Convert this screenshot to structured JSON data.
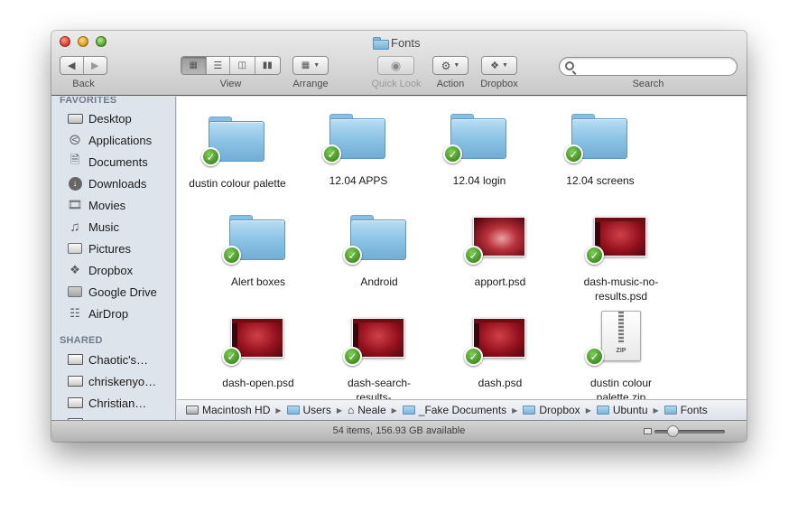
{
  "window": {
    "title": "Fonts"
  },
  "toolbar": {
    "back_label": "Back",
    "view_label": "View",
    "arrange_label": "Arrange",
    "quicklook_label": "Quick Look",
    "action_label": "Action",
    "dropbox_label": "Dropbox",
    "search_label": "Search",
    "search_value": "",
    "view_mode": "icon"
  },
  "sidebar": {
    "favorites_header": "FAVORITES",
    "favorites": [
      {
        "label": "Desktop",
        "icon": "desktop-icon"
      },
      {
        "label": "Applications",
        "icon": "applications-icon"
      },
      {
        "label": "Documents",
        "icon": "documents-icon"
      },
      {
        "label": "Downloads",
        "icon": "downloads-icon"
      },
      {
        "label": "Movies",
        "icon": "movies-icon"
      },
      {
        "label": "Music",
        "icon": "music-icon"
      },
      {
        "label": "Pictures",
        "icon": "pictures-icon"
      },
      {
        "label": "Dropbox",
        "icon": "dropbox-icon"
      },
      {
        "label": "Google Drive",
        "icon": "folder-icon"
      },
      {
        "label": "AirDrop",
        "icon": "airdrop-icon"
      }
    ],
    "shared_header": "SHARED",
    "shared": [
      {
        "label": "Chaotic's…",
        "icon": "computer-icon"
      },
      {
        "label": "chriskenyo…",
        "icon": "computer-icon"
      },
      {
        "label": "Christian…",
        "icon": "computer-icon"
      }
    ]
  },
  "files": [
    {
      "name": "dustin colour palette",
      "kind": "folder",
      "synced": true
    },
    {
      "name": "12.04 APPS",
      "kind": "folder",
      "synced": true
    },
    {
      "name": "12.04 login",
      "kind": "folder",
      "synced": true
    },
    {
      "name": "12.04 screens",
      "kind": "folder",
      "synced": true
    },
    {
      "name": "Alert boxes",
      "kind": "folder",
      "synced": true
    },
    {
      "name": "Android",
      "kind": "folder",
      "synced": true
    },
    {
      "name": "apport.psd",
      "kind": "psd",
      "synced": true
    },
    {
      "name": "dash-music-no-results.psd",
      "kind": "psd",
      "synced": true
    },
    {
      "name": "dash-open.psd",
      "kind": "psd",
      "synced": true
    },
    {
      "name": "dash-search-results-…nded.psd",
      "kind": "psd",
      "synced": true
    },
    {
      "name": "dash.psd",
      "kind": "psd",
      "synced": true
    },
    {
      "name": "dustin colour palette.zip",
      "kind": "zip",
      "synced": true
    }
  ],
  "zip_badge": "ZIP",
  "pathbar": [
    {
      "label": "Macintosh HD",
      "icon": "hard-drive-icon"
    },
    {
      "label": "Users",
      "icon": "folder-icon"
    },
    {
      "label": "Neale",
      "icon": "home-icon"
    },
    {
      "label": "_Fake Documents",
      "icon": "folder-icon"
    },
    {
      "label": "Dropbox",
      "icon": "folder-icon"
    },
    {
      "label": "Ubuntu",
      "icon": "folder-icon"
    },
    {
      "label": "Fonts",
      "icon": "folder-icon"
    }
  ],
  "status": {
    "text": "54 items, 156.93 GB available",
    "icon_size": 0.25
  }
}
